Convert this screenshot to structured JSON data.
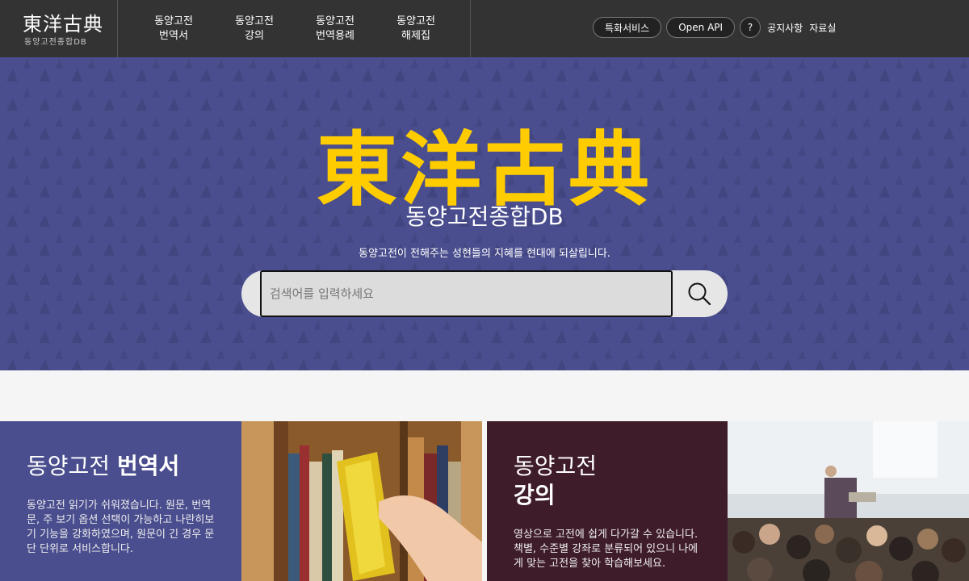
{
  "header": {
    "logo_main": "東洋古典",
    "logo_sub": "동양고전종합DB",
    "nav": [
      {
        "line1": "동양고전",
        "line2": "번역서"
      },
      {
        "line1": "동양고전",
        "line2": "강의"
      },
      {
        "line1": "동양고전",
        "line2": "번역용례"
      },
      {
        "line1": "동양고전",
        "line2": "해제집"
      }
    ],
    "special_service": "특화서비스",
    "open_api": "Open API",
    "help": "?",
    "notice": "공지사항",
    "archive": "자료실"
  },
  "hero": {
    "title": "東洋古典",
    "subtitle": "동양고전종합DB",
    "description": "동양고전이 전해주는 성현들의 지혜를 현대에 되살립니다.",
    "search_placeholder": "검색어를 입력하세요",
    "search_icon": "search-icon"
  },
  "cards": [
    {
      "title_light": "동양고전 ",
      "title_bold": "번역서",
      "description": "동양고전 읽기가 쉬워졌습니다. 원문, 번역문, 주 보기 옵션 선택이 가능하고 나란히보기 기능을 강화하였으며, 원문이 긴 경우 문단 단위로 서비스합니다."
    },
    {
      "title_light": "동양고전",
      "title_bold": "강의",
      "description": "영상으로 고전에 쉽게 다가갈 수 있습니다. 책별, 수준별 강좌로 분류되어 있으니 나에게 맞는 고전을 찾아 학습해보세요."
    }
  ],
  "colors": {
    "header_bg": "#333333",
    "hero_bg": "#4a4e8e",
    "hero_title": "#ffcc00",
    "card1_bg": "#4a4e8e",
    "card2_bg": "#3f1c2a"
  }
}
